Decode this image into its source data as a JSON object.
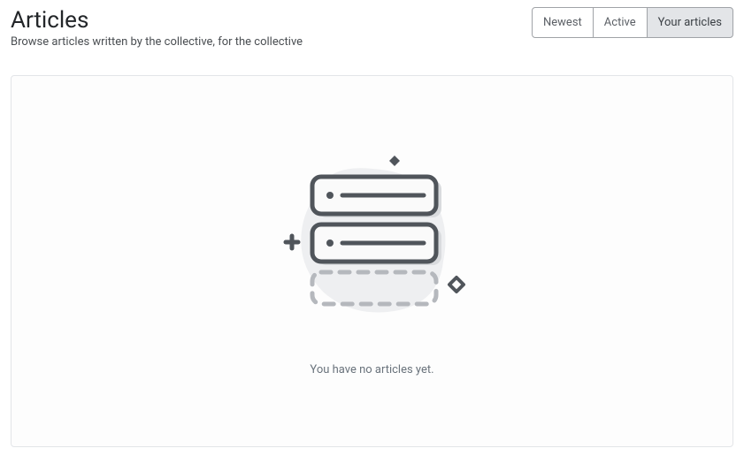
{
  "header": {
    "title": "Articles",
    "subtitle": "Browse articles written by the collective, for the collective"
  },
  "tabs": {
    "items": [
      {
        "label": "Newest",
        "active": false
      },
      {
        "label": "Active",
        "active": false
      },
      {
        "label": "Your articles",
        "active": true
      }
    ]
  },
  "empty": {
    "message": "You have no articles yet."
  }
}
